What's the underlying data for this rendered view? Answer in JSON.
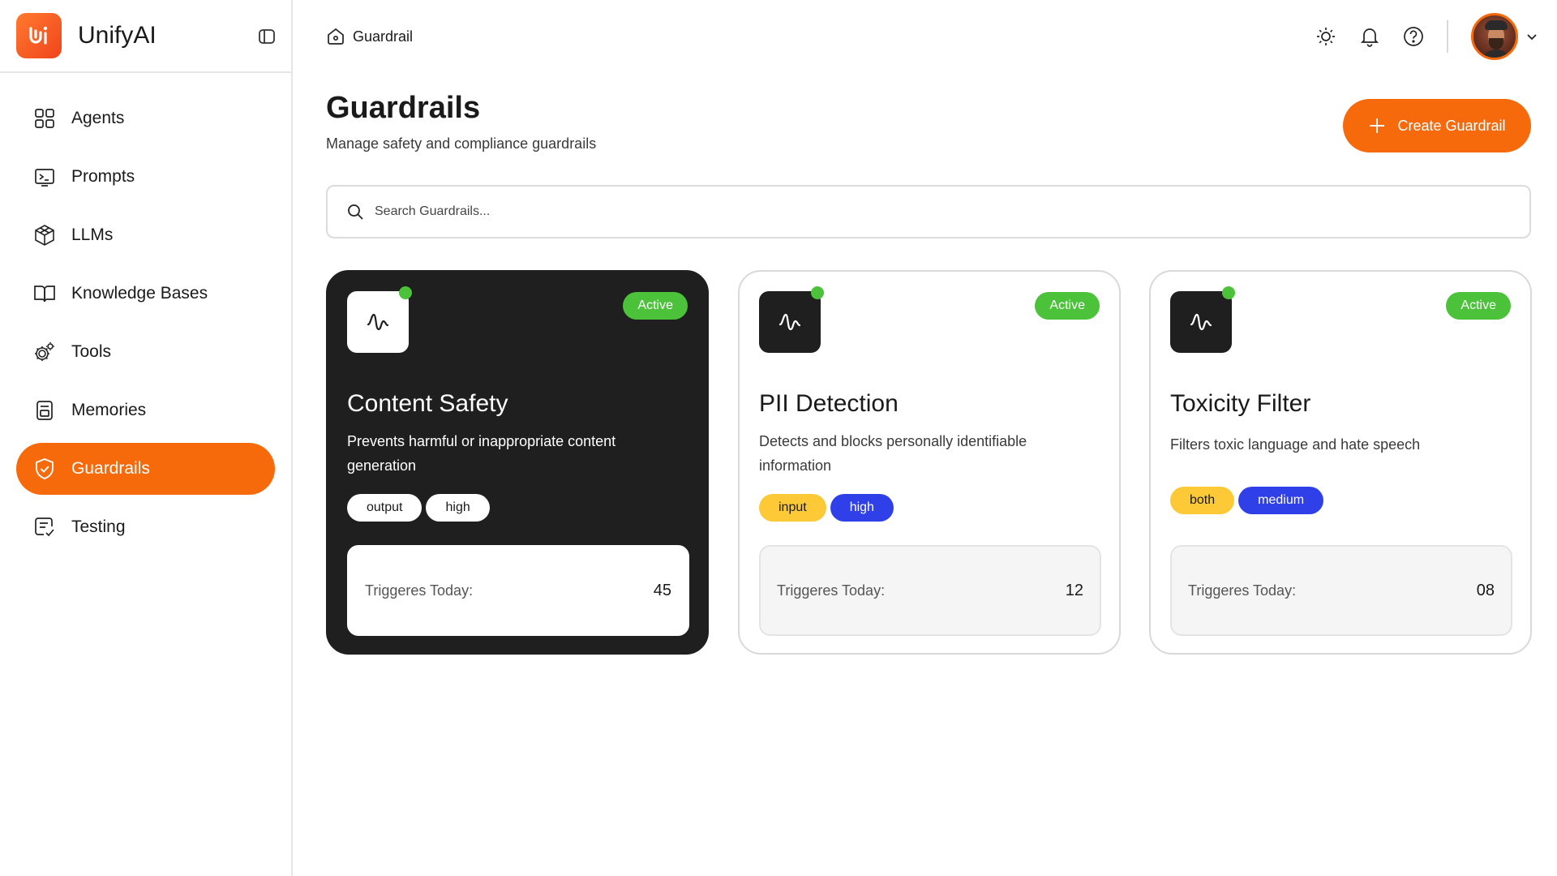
{
  "app": {
    "name": "UnifyAI"
  },
  "sidebar": {
    "items": [
      {
        "label": "Agents",
        "icon": "grid-icon",
        "active": false
      },
      {
        "label": "Prompts",
        "icon": "terminal-icon",
        "active": false
      },
      {
        "label": "LLMs",
        "icon": "cube-network-icon",
        "active": false
      },
      {
        "label": "Knowledge Bases",
        "icon": "book-icon",
        "active": false
      },
      {
        "label": "Tools",
        "icon": "gears-icon",
        "active": false
      },
      {
        "label": "Memories",
        "icon": "memory-icon",
        "active": false
      },
      {
        "label": "Guardrails",
        "icon": "shield-icon",
        "active": true
      },
      {
        "label": "Testing",
        "icon": "testing-icon",
        "active": false
      }
    ]
  },
  "header": {
    "breadcrumb": "Guardrail"
  },
  "main": {
    "title": "Guardrails",
    "subtitle": "Manage safety and compliance guardrails",
    "create_button": "Create Guardrail",
    "search_placeholder": "Search Guardrails..."
  },
  "cards": [
    {
      "title": "Content Safety",
      "description": "Prevents harmful or inappropriate content generation",
      "status": "Active",
      "tags": [
        "output",
        "high"
      ],
      "stat_label": "Triggeres Today:",
      "stat_value": "45"
    },
    {
      "title": "PII Detection",
      "description": "Detects and blocks personally identifiable information",
      "status": "Active",
      "tags": [
        "input",
        "high"
      ],
      "stat_label": "Triggeres Today:",
      "stat_value": "12"
    },
    {
      "title": "Toxicity Filter",
      "description": "Filters toxic language and hate speech",
      "status": "Active",
      "tags": [
        "both",
        "medium"
      ],
      "stat_label": "Triggeres Today:",
      "stat_value": "08"
    }
  ],
  "colors": {
    "accent": "#f76a0c",
    "active_status": "#4cc13a",
    "tag_yellow": "#fdc936",
    "tag_blue": "#3040e8",
    "dark_card": "#1f1f1f"
  }
}
